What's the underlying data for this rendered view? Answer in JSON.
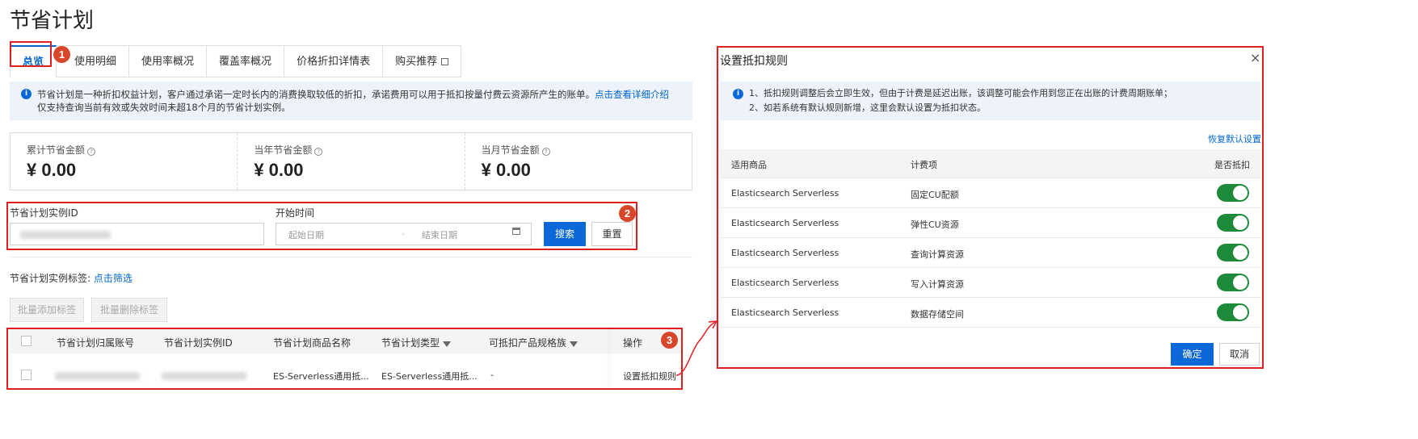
{
  "page": {
    "title": "节省计划"
  },
  "tabs": [
    {
      "label": "总览",
      "active": true
    },
    {
      "label": "使用明细"
    },
    {
      "label": "使用率概况"
    },
    {
      "label": "覆盖率概况"
    },
    {
      "label": "价格折扣详情表"
    },
    {
      "label": "购买推荐"
    }
  ],
  "badges": [
    "1",
    "2",
    "3"
  ],
  "notice": {
    "line1": "节省计划是一种折扣权益计划，客户通过承诺一定时长内的消费换取较低的折扣，承诺费用可以用于抵扣按量付费云资源所产生的账单。",
    "link": "点击查看详细介绍",
    "line2": "仅支持查询当前有效或失效时间未超18个月的节省计划实例。"
  },
  "stats": [
    {
      "label": "累计节省金额",
      "value": "¥ 0.00"
    },
    {
      "label": "当年节省金额",
      "value": "¥ 0.00"
    },
    {
      "label": "当月节省金额",
      "value": "¥ 0.00"
    }
  ],
  "filter": {
    "instance_id_label": "节省计划实例ID",
    "start_time_label": "开始时间",
    "start_date_placeholder": "起始日期",
    "separator": "-",
    "end_date_placeholder": "结束日期",
    "search": "搜索",
    "reset": "重置"
  },
  "tags": {
    "label": "节省计划实例标签:",
    "filter_link": "点击筛选",
    "batch_add": "批量添加标签",
    "batch_remove": "批量删除标签"
  },
  "table": {
    "columns": [
      "节省计划归属账号",
      "节省计划实例ID",
      "节省计划商品名称",
      "节省计划类型",
      "可抵扣产品规格族",
      "操作"
    ],
    "rows": [
      {
        "product_name": "ES-Serverless通用抵...",
        "type": "ES-Serverless通用抵...",
        "spec_family": "-",
        "action": "设置抵扣规则"
      }
    ]
  },
  "dialog": {
    "title": "设置抵扣规则",
    "close": "×",
    "notes": [
      "1、抵扣规则调整后会立即生效，但由于计费是延迟出账，该调整可能会作用到您正在出账的计费周期账单；",
      "2、如若系统有默认规则新增，这里会默认设置为抵扣状态。"
    ],
    "restore_link": "恢复默认设置",
    "columns": [
      "适用商品",
      "计费项",
      "是否抵扣"
    ],
    "rows": [
      {
        "product": "Elasticsearch Serverless",
        "item": "固定CU配额",
        "enabled": true
      },
      {
        "product": "Elasticsearch Serverless",
        "item": "弹性CU资源",
        "enabled": true
      },
      {
        "product": "Elasticsearch Serverless",
        "item": "查询计算资源",
        "enabled": true
      },
      {
        "product": "Elasticsearch Serverless",
        "item": "写入计算资源",
        "enabled": true
      },
      {
        "product": "Elasticsearch Serverless",
        "item": "数据存储空间",
        "enabled": true
      }
    ],
    "confirm": "确定",
    "cancel": "取消"
  },
  "colors": {
    "primary": "#0b68d8",
    "annotation": "#e02020",
    "toggle_on": "#1d8a3a"
  }
}
